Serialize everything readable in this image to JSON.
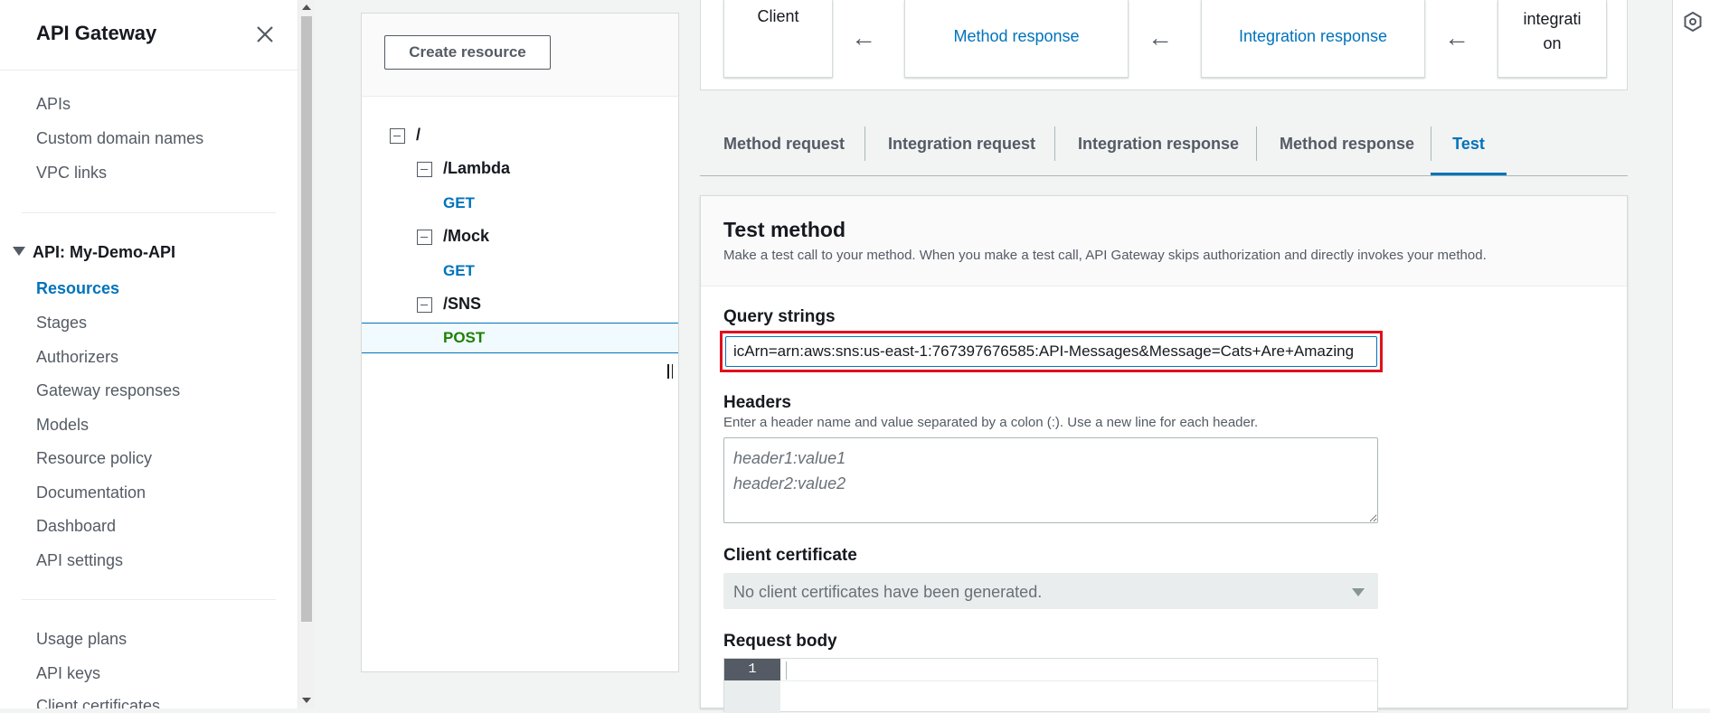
{
  "sidenav": {
    "title": "API Gateway",
    "items_top": [
      "APIs",
      "Custom domain names",
      "VPC links"
    ],
    "api_group": "API: My-Demo-API",
    "api_items": [
      "Resources",
      "Stages",
      "Authorizers",
      "Gateway responses",
      "Models",
      "Resource policy",
      "Documentation",
      "Dashboard",
      "API settings"
    ],
    "active_item": "Resources",
    "items_bottom": [
      "Usage plans",
      "API keys",
      "Client certificates"
    ]
  },
  "resources": {
    "create_button": "Create resource",
    "root": "/",
    "lambda_path": "/Lambda",
    "lambda_method": "GET",
    "mock_path": "/Mock",
    "mock_method": "GET",
    "sns_path": "/SNS",
    "sns_method": "POST"
  },
  "flow": {
    "client": "Client",
    "method_response": "Method response",
    "integration_response": "Integration response",
    "integration_line1": "integrati",
    "integration_line2": "on",
    "arrow": "←"
  },
  "tabs": [
    "Method request",
    "Integration request",
    "Integration response",
    "Method response",
    "Test"
  ],
  "active_tab": "Test",
  "test": {
    "title": "Test method",
    "description": "Make a test call to your method. When you make a test call, API Gateway skips authorization and directly invokes your method.",
    "query_label": "Query strings",
    "query_value": "icArn=arn:aws:sns:us-east-1:767397676585:API-Messages&Message=Cats+Are+Amazing",
    "headers_label": "Headers",
    "headers_desc": "Enter a header name and value separated by a colon (:). Use a new line for each header.",
    "headers_placeholder": "header1:value1\nheader2:value2",
    "cert_label": "Client certificate",
    "cert_value": "No client certificates have been generated.",
    "body_label": "Request body",
    "line_number": "1"
  },
  "colors": {
    "link": "#0073bb",
    "post_method": "#1d8102",
    "highlight_border": "#e0101c"
  }
}
